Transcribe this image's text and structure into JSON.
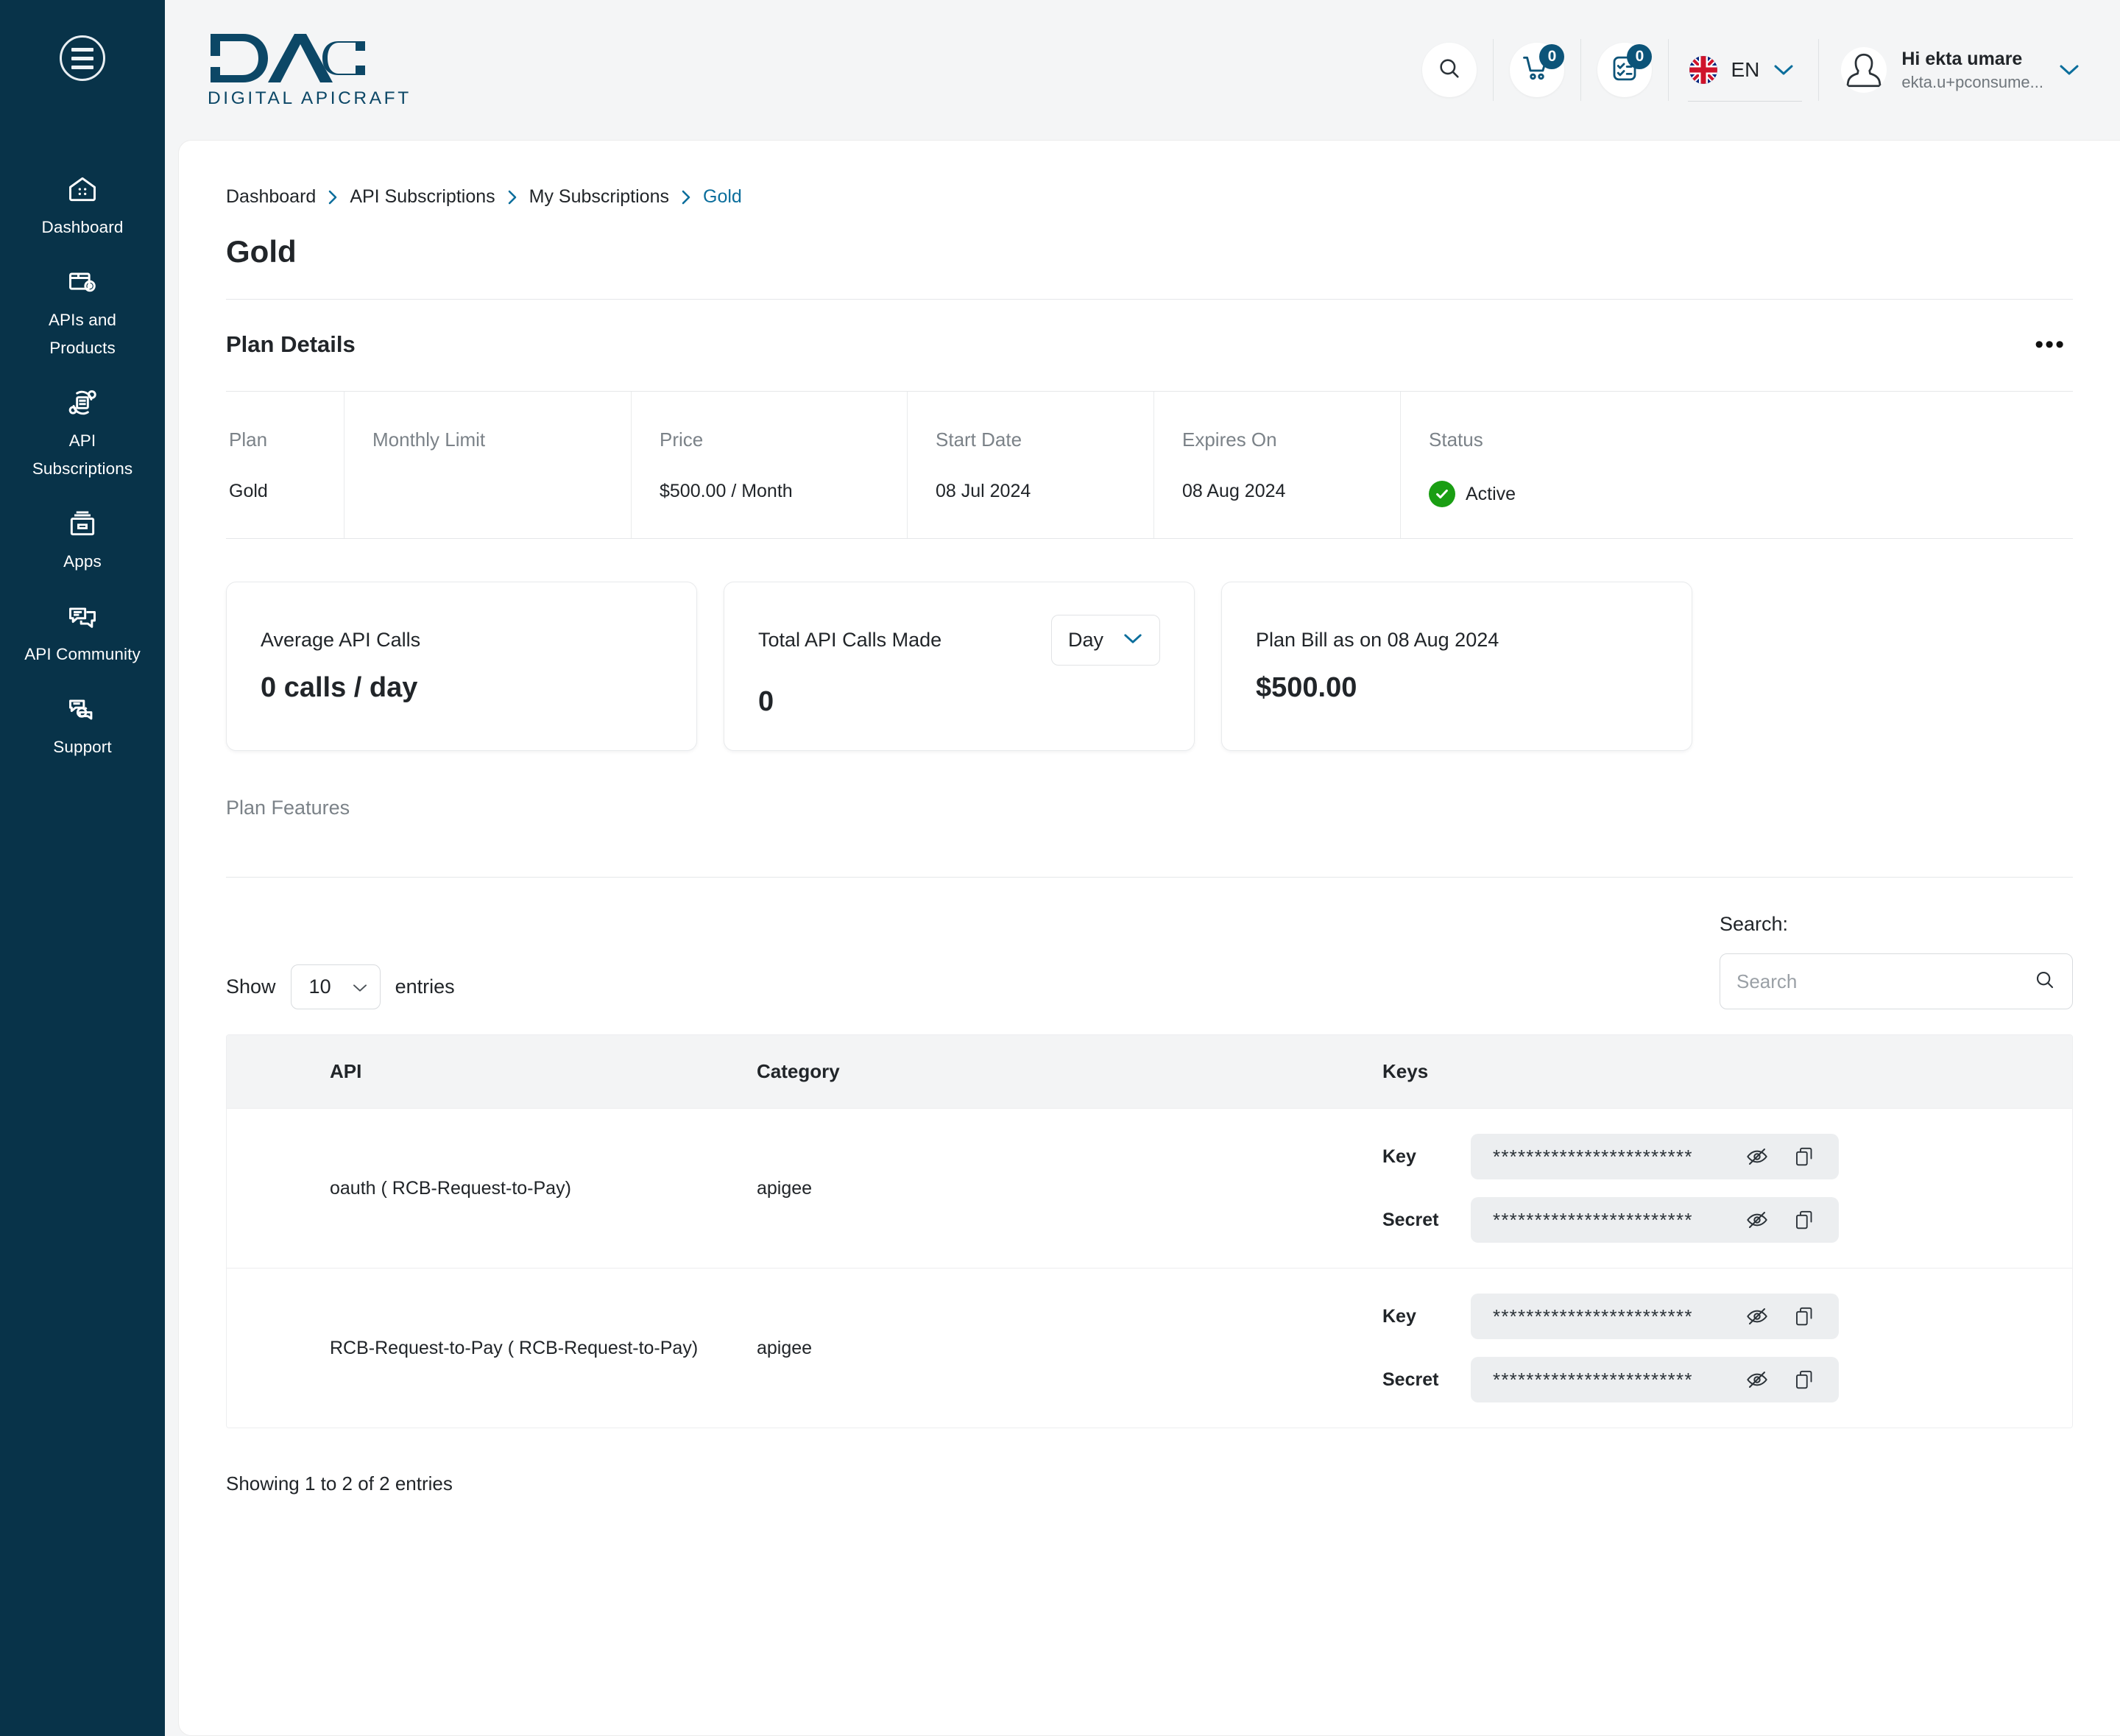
{
  "sidebar": {
    "menu_icon": "hamburger-icon",
    "items": [
      {
        "label": "Dashboard",
        "icon": "dashboard-icon"
      },
      {
        "label": "APIs and Products",
        "icon": "apis-products-icon"
      },
      {
        "label": "API Subscriptions",
        "icon": "api-subscriptions-icon"
      },
      {
        "label": "Apps",
        "icon": "apps-icon"
      },
      {
        "label": "API Community",
        "icon": "api-community-icon"
      },
      {
        "label": "Support",
        "icon": "support-icon"
      }
    ]
  },
  "header": {
    "logo_text": "DAC",
    "logo_subtitle": "DIGITAL APICRAFT",
    "search_icon": "search-icon",
    "cart_icon": "cart-icon",
    "cart_badge": "0",
    "tasks_icon": "checklist-icon",
    "tasks_badge": "0",
    "language": "EN",
    "language_flag": "uk-flag-icon",
    "user_greeting": "Hi ekta umare",
    "user_email": "ekta.u+pconsume...",
    "avatar_icon": "avatar-icon",
    "chevron_icon": "chevron-down-icon"
  },
  "breadcrumb": {
    "items": [
      {
        "label": "Dashboard",
        "current": false
      },
      {
        "label": "API Subscriptions",
        "current": false
      },
      {
        "label": "My Subscriptions",
        "current": false
      },
      {
        "label": "Gold",
        "current": true
      }
    ]
  },
  "page": {
    "title": "Gold"
  },
  "plan_details": {
    "section_title": "Plan Details",
    "kebab_label": "•••",
    "headers": [
      "Plan",
      "Monthly Limit",
      "Price",
      "Start Date",
      "Expires On",
      "Status"
    ],
    "values": {
      "plan": "Gold",
      "monthly_limit": "",
      "price": "$500.00 / Month",
      "start_date": "08 Jul 2024",
      "expires_on": "08 Aug 2024",
      "status": "Active",
      "status_icon": "check-circle-icon",
      "status_color": "#1a9e13"
    }
  },
  "metrics": [
    {
      "label": "Average API Calls",
      "value": "0 calls / day"
    },
    {
      "label": "Total API Calls Made",
      "value": "0",
      "select_value": "Day"
    },
    {
      "label": "Plan Bill as on 08 Aug 2024",
      "value": "$500.00"
    }
  ],
  "plan_features": {
    "label": "Plan Features"
  },
  "table_controls": {
    "show_label": "Show",
    "show_value": "10",
    "entries_label": "entries",
    "search_label": "Search:",
    "search_value": "",
    "search_placeholder": "Search",
    "search_icon": "search-icon"
  },
  "api_table": {
    "headers": [
      "API",
      "Category",
      "Keys"
    ],
    "rows": [
      {
        "api": "oauth ( RCB-Request-to-Pay)",
        "category": "apigee",
        "keys": [
          {
            "label": "Key",
            "mask": "************************"
          },
          {
            "label": "Secret",
            "mask": "************************"
          }
        ]
      },
      {
        "api": "RCB-Request-to-Pay ( RCB-Request-to-Pay)",
        "category": "apigee",
        "keys": [
          {
            "label": "Key",
            "mask": "************************"
          },
          {
            "label": "Secret",
            "mask": "************************"
          }
        ]
      }
    ],
    "footer": "Showing 1 to 2 of 2 entries",
    "eye_icon": "eye-off-icon",
    "copy_icon": "copy-icon"
  },
  "colors": {
    "sidebar_bg": "#083349",
    "brand": "#0c4766",
    "accent": "#0b6e9c",
    "status_green": "#1a9e13",
    "page_bg": "#f4f5f6"
  }
}
